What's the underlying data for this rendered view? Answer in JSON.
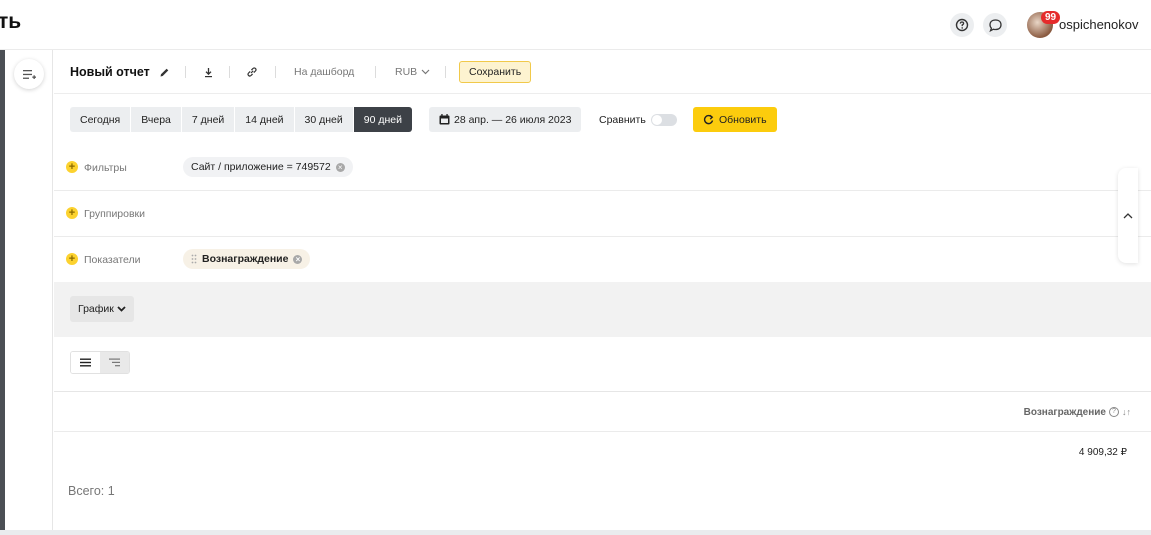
{
  "header": {
    "brand_fragment": "ть",
    "username": "ospichenokov",
    "notification_count": "99",
    "icons": [
      "help-icon",
      "chat-icon"
    ]
  },
  "toolbar": {
    "report_title": "Новый отчет",
    "dashboard_label": "На дашборд",
    "currency": "RUB",
    "save_label": "Сохранить"
  },
  "period": {
    "buttons": [
      "Сегодня",
      "Вчера",
      "7 дней",
      "14 дней",
      "30 дней",
      "90 дней"
    ],
    "active": "90 дней",
    "date_range": "28 апр. — 26 июля 2023",
    "compare_label": "Сравнить",
    "refresh_label": "Обновить"
  },
  "filters": {
    "filters_label": "Фильтры",
    "filter_chip": "Сайт / приложение = 749572",
    "groupings_label": "Группировки",
    "metrics_label": "Показатели",
    "metric_chip": "Вознаграждение"
  },
  "view": {
    "chart_label": "График"
  },
  "table": {
    "column_header": "Вознаграждение",
    "value": "4 909,32 ₽",
    "total_label": "Всего: 1"
  },
  "colors": {
    "accent_yellow": "#fccc0d",
    "active_period": "#3d4147",
    "notif_red": "#e52b2b"
  }
}
